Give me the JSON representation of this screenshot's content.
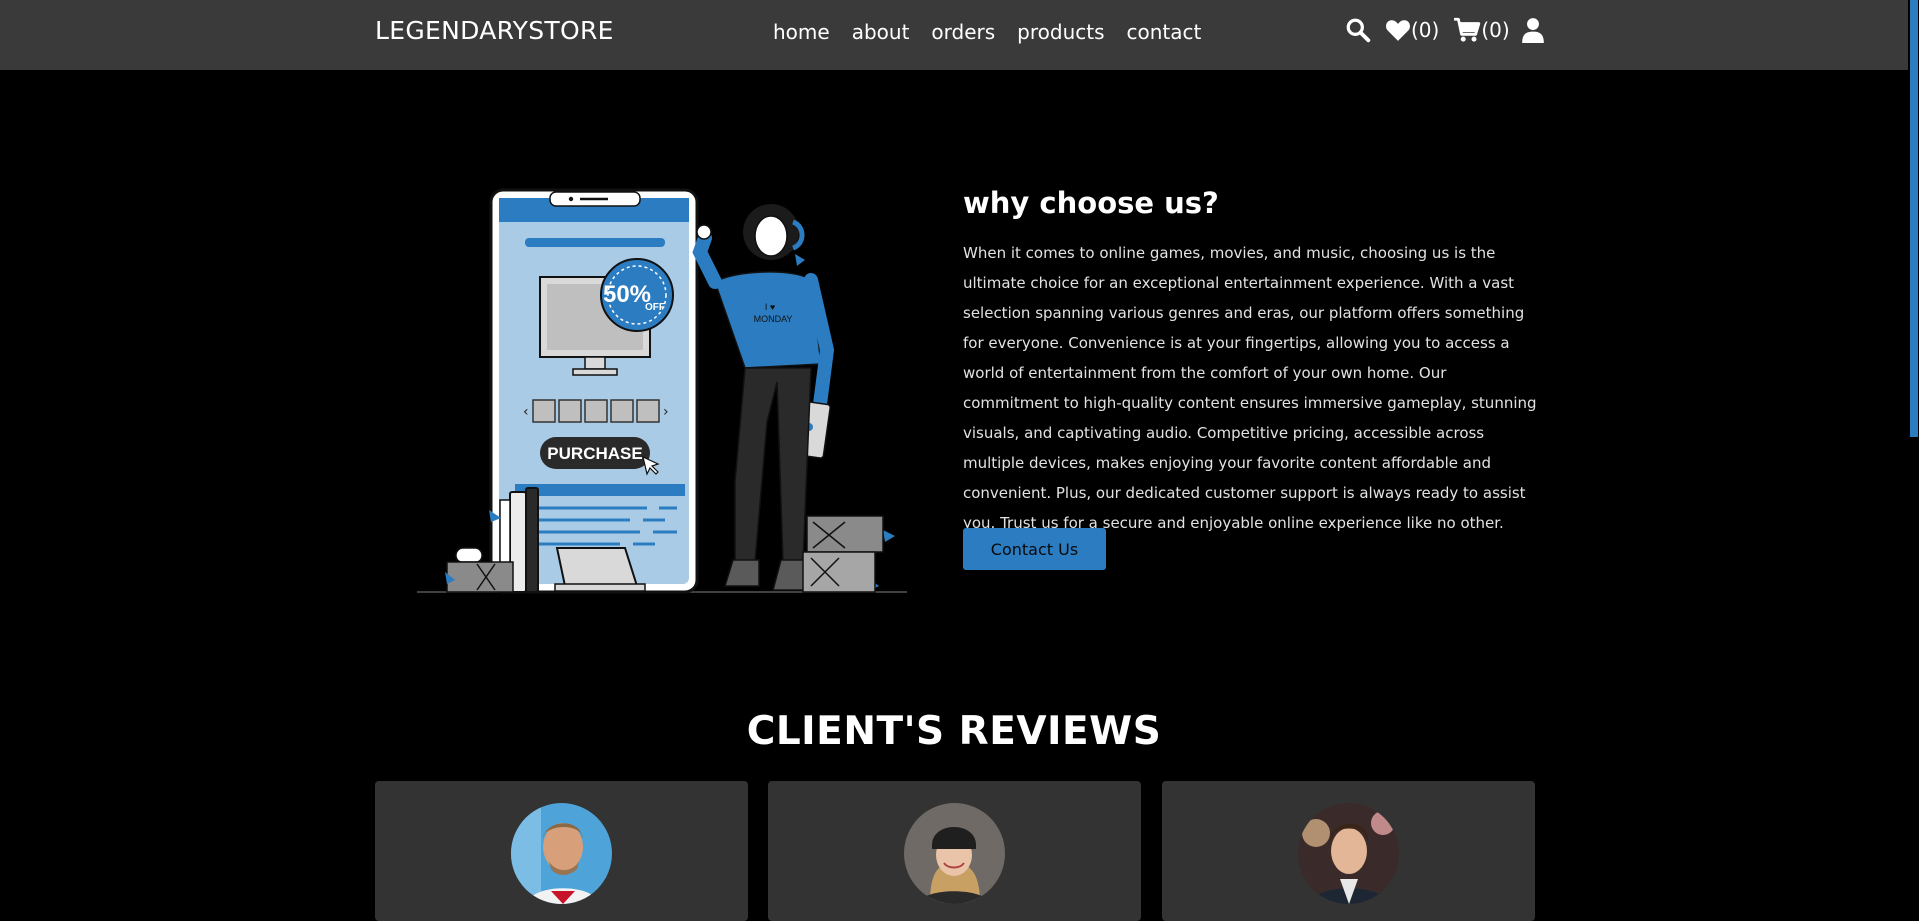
{
  "header": {
    "brand": "LEGENDARYSTORE",
    "nav": [
      "home",
      "about",
      "orders",
      "products",
      "contact"
    ],
    "wishlist_count": "(0)",
    "cart_count": "(0)"
  },
  "why": {
    "title": "why choose us?",
    "text": "When it comes to online games, movies, and music, choosing us is the ultimate choice for an exceptional entertainment experience. With a vast selection spanning various genres and eras, our platform offers something for everyone. Convenience is at your fingertips, allowing you to access a world of entertainment from the comfort of your own home. Our commitment to high-quality content ensures immersive gameplay, stunning visuals, and captivating audio. Competitive pricing, accessible across multiple devices, makes enjoying your favorite content affordable and convenient. Plus, our dedicated customer support is always ready to assist you. Trust us for a secure and enjoyable online experience like no other.",
    "button": "Contact Us"
  },
  "illustration": {
    "badge_big": "50%",
    "badge_small": "OFF",
    "purchase": "PURCHASE",
    "shirt_line1": "I ♥",
    "shirt_line2": "MONDAY"
  },
  "reviews": {
    "title": "CLIENT'S REVIEWS"
  },
  "colors": {
    "accent": "#2b7cc0",
    "header_bg": "#3a3a3a",
    "card_bg": "#333333",
    "page_bg": "#000000"
  }
}
